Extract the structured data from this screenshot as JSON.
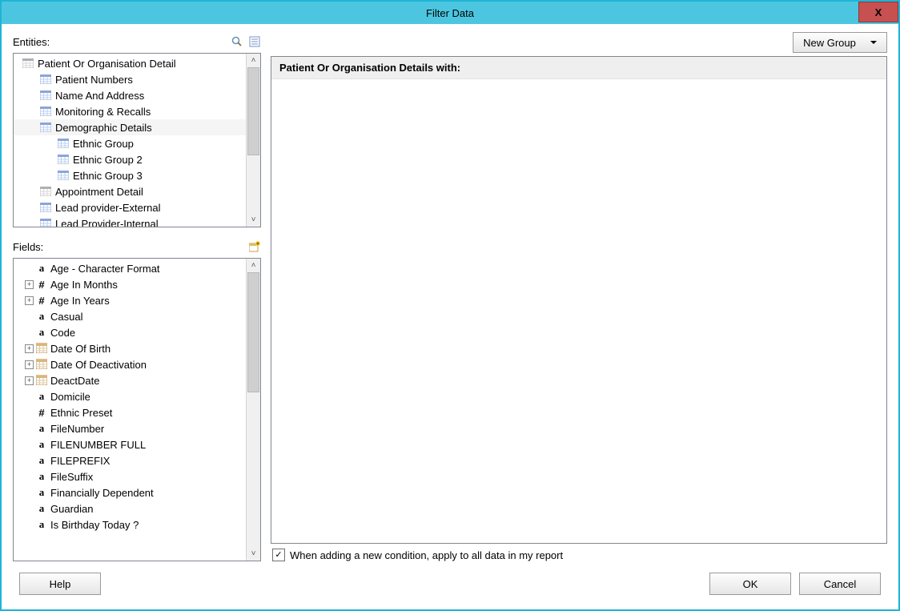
{
  "window": {
    "title": "Filter Data",
    "close": "X"
  },
  "entities": {
    "label": "Entities:",
    "items": [
      {
        "indent": 0,
        "icon": "table-grey",
        "label": "Patient Or Organisation Detail"
      },
      {
        "indent": 1,
        "icon": "table-blue",
        "label": "Patient Numbers"
      },
      {
        "indent": 1,
        "icon": "table-blue",
        "label": "Name And Address"
      },
      {
        "indent": 1,
        "icon": "table-blue",
        "label": "Monitoring & Recalls"
      },
      {
        "indent": 1,
        "icon": "table-blue",
        "label": "Demographic Details",
        "selected": true
      },
      {
        "indent": 2,
        "icon": "table-blue",
        "label": "Ethnic Group"
      },
      {
        "indent": 2,
        "icon": "table-blue",
        "label": "Ethnic Group 2"
      },
      {
        "indent": 2,
        "icon": "table-blue",
        "label": "Ethnic Group 3"
      },
      {
        "indent": 1,
        "icon": "table-grey",
        "label": "Appointment Detail"
      },
      {
        "indent": 1,
        "icon": "table-blue",
        "label": "Lead provider-External"
      },
      {
        "indent": 1,
        "icon": "table-blue",
        "label": "Lead Provider-Internal"
      }
    ]
  },
  "fields": {
    "label": "Fields:",
    "items": [
      {
        "exp": "",
        "type": "a",
        "label": "Age - Character Format"
      },
      {
        "exp": "+",
        "type": "#",
        "label": "Age In Months"
      },
      {
        "exp": "+",
        "type": "#",
        "label": "Age In Years"
      },
      {
        "exp": "",
        "type": "a",
        "label": "Casual"
      },
      {
        "exp": "",
        "type": "a",
        "label": "Code"
      },
      {
        "exp": "+",
        "type": "cal",
        "label": "Date Of Birth"
      },
      {
        "exp": "+",
        "type": "cal",
        "label": "Date Of Deactivation"
      },
      {
        "exp": "+",
        "type": "cal",
        "label": "DeactDate"
      },
      {
        "exp": "",
        "type": "a",
        "label": "Domicile"
      },
      {
        "exp": "",
        "type": "#",
        "label": "Ethnic Preset"
      },
      {
        "exp": "",
        "type": "a",
        "label": "FileNumber"
      },
      {
        "exp": "",
        "type": "a",
        "label": "FILENUMBER FULL"
      },
      {
        "exp": "",
        "type": "a",
        "label": "FILEPREFIX"
      },
      {
        "exp": "",
        "type": "a",
        "label": "FileSuffix"
      },
      {
        "exp": "",
        "type": "a",
        "label": "Financially Dependent"
      },
      {
        "exp": "",
        "type": "a",
        "label": "Guardian"
      },
      {
        "exp": "",
        "type": "a",
        "label": "Is Birthday Today ?"
      }
    ]
  },
  "right": {
    "new_group": "New Group",
    "filter_title": "Patient Or Organisation Details with:",
    "checkbox_label": "When adding a new condition, apply to all data in my report",
    "checked": true
  },
  "buttons": {
    "help": "Help",
    "ok": "OK",
    "cancel": "Cancel"
  }
}
